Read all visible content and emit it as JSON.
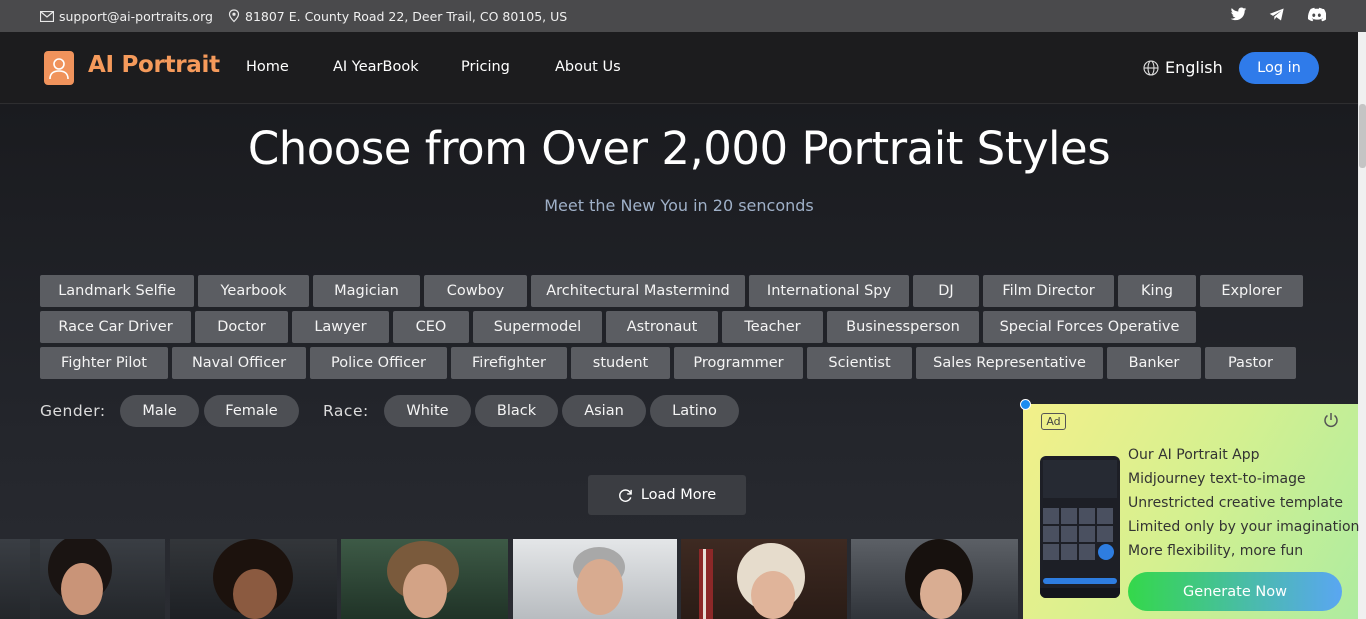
{
  "topbar": {
    "email": "support@ai-portraits.org",
    "address": "81807 E. County Road 22, Deer Trail, CO 80105, US",
    "socials": [
      "twitter-icon",
      "telegram-icon",
      "discord-icon"
    ]
  },
  "nav": {
    "brand": "AI Portrait",
    "links": [
      "Home",
      "AI YearBook",
      "Pricing",
      "About Us"
    ],
    "language": "English",
    "login": "Log in"
  },
  "hero": {
    "title": "Choose from Over 2,000 Portrait Styles",
    "subtitle": "Meet the New You in 20 senconds"
  },
  "styles": {
    "row1": [
      "Landmark Selfie",
      "Yearbook",
      "Magician",
      "Cowboy",
      "Architectural Mastermind",
      "International Spy",
      "DJ",
      "Film Director",
      "King",
      "Explorer"
    ],
    "row2": [
      "Race Car Driver",
      "Doctor",
      "Lawyer",
      "CEO",
      "Supermodel",
      "Astronaut",
      "Teacher",
      "Businessperson",
      "Special Forces Operative"
    ],
    "row3": [
      "Fighter Pilot",
      "Naval Officer",
      "Police Officer",
      "Firefighter",
      "student",
      "Programmer",
      "Scientist",
      "Sales Representative",
      "Banker",
      "Pastor"
    ]
  },
  "filters": {
    "gender_label": "Gender:",
    "gender": [
      "Male",
      "Female"
    ],
    "race_label": "Race:",
    "race": [
      "White",
      "Black",
      "Asian",
      "Latino"
    ]
  },
  "load_more": "Load More",
  "ad": {
    "badge": "Ad",
    "lines": [
      "Our AI Portrait App",
      "Midjourney text-to-image",
      "Unrestricted creative template",
      "Limited only by your imagination",
      "More flexibility, more fun"
    ],
    "cta": "Generate Now"
  },
  "colors": {
    "brand": "#f59a5b",
    "login": "#2f7bea",
    "tag": "#5b5d62"
  }
}
